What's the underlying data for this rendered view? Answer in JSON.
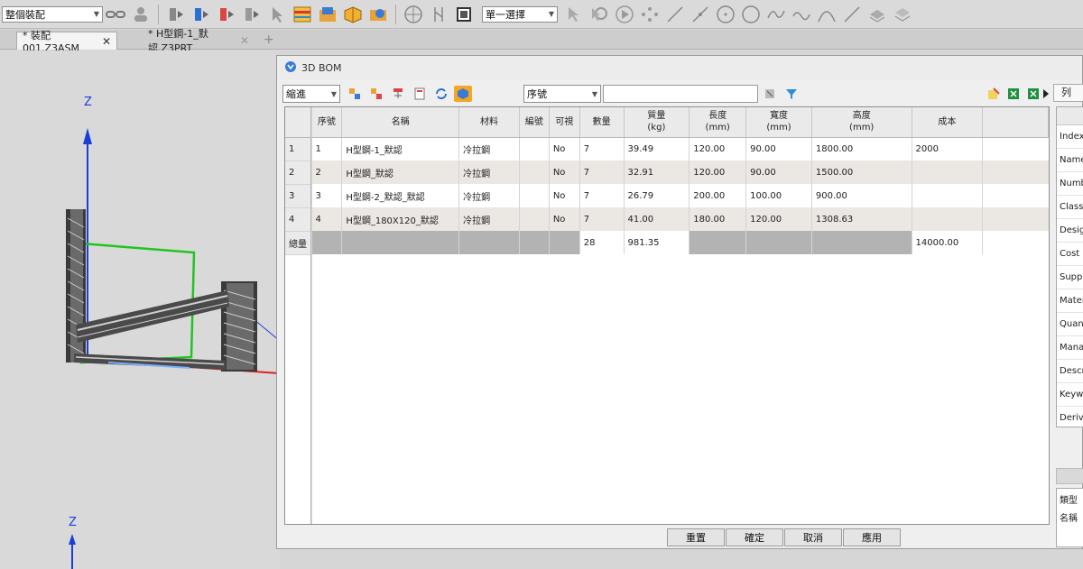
{
  "toolbar": {
    "assembly_mode": "整個裝配",
    "selection_mode": "單一選擇"
  },
  "tabs": [
    {
      "label": "* 裝配001.Z3ASM",
      "close": "✕"
    },
    {
      "label": "* H型鋼-1_默認.Z3PRT",
      "close": "✕"
    }
  ],
  "viewport": {
    "axis_z_label": "Z",
    "axis_z2_label": "Z"
  },
  "dialog": {
    "title": "3D BOM",
    "indent_combo": "縮進",
    "sort_combo": "序號",
    "search_value": "",
    "columns": [
      {
        "label": "序號",
        "unit": ""
      },
      {
        "label": "名稱",
        "unit": ""
      },
      {
        "label": "材料",
        "unit": ""
      },
      {
        "label": "編號",
        "unit": ""
      },
      {
        "label": "可視",
        "unit": ""
      },
      {
        "label": "數量",
        "unit": ""
      },
      {
        "label": "質量",
        "unit": "(kg)"
      },
      {
        "label": "長度",
        "unit": "(mm)"
      },
      {
        "label": "寬度",
        "unit": "(mm)"
      },
      {
        "label": "高度",
        "unit": "(mm)"
      },
      {
        "label": "成本",
        "unit": ""
      }
    ],
    "rows": [
      {
        "rownum": "1",
        "cells": [
          "1",
          "H型鋼-1_默認",
          "冷拉鋼",
          "",
          "No",
          "7",
          "39.49",
          "120.00",
          "90.00",
          "1800.00",
          "2000"
        ]
      },
      {
        "rownum": "2",
        "cells": [
          "2",
          "H型鋼_默認",
          "冷拉鋼",
          "",
          "No",
          "7",
          "32.91",
          "120.00",
          "90.00",
          "1500.00",
          ""
        ]
      },
      {
        "rownum": "3",
        "cells": [
          "3",
          "H型鋼-2_默認_默認",
          "冷拉鋼",
          "",
          "No",
          "7",
          "26.79",
          "200.00",
          "100.00",
          "900.00",
          ""
        ]
      },
      {
        "rownum": "4",
        "cells": [
          "4",
          "H型鋼_180X120_默認",
          "冷拉鋼",
          "",
          "No",
          "7",
          "41.00",
          "180.00",
          "120.00",
          "1308.63",
          ""
        ]
      }
    ],
    "total": {
      "label": "總量",
      "cells": [
        "",
        "",
        "",
        "",
        "",
        "28",
        "981.35",
        "",
        "",
        "",
        "14000.00"
      ]
    },
    "buttons": {
      "reset": "重置",
      "ok": "確定",
      "cancel": "取消",
      "apply": "應用"
    },
    "right_panel": {
      "tab_label": "列",
      "header_label": "",
      "items": [
        "Index",
        "Name",
        "Numb",
        "Class",
        "Desig",
        "Cost",
        "Suppl",
        "Mater",
        "Quan",
        "Mana",
        "Descr",
        "Keyw",
        "Deriv"
      ],
      "bottom_items": [
        "類型",
        "名稱"
      ]
    }
  },
  "colors": {
    "accent_orange": "#f5a623",
    "axis_blue": "#1a3fd6",
    "axis_red": "#e02020",
    "axis_green": "#22c422",
    "row_alt": "#ebe7e3",
    "total_row": "#b3b3b3"
  }
}
